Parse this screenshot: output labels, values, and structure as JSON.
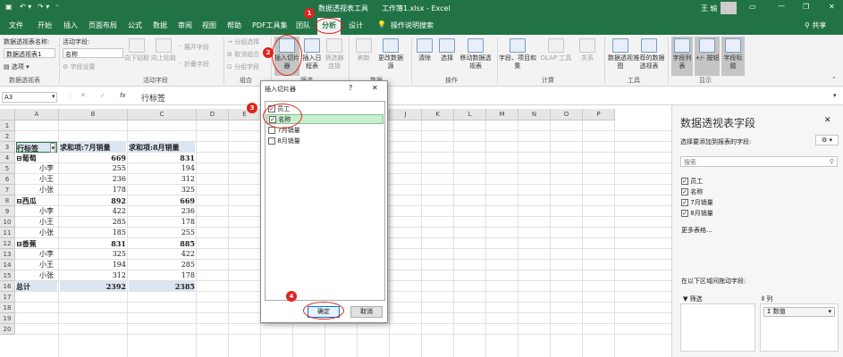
{
  "title_bar": {
    "context_tool": "数据透视表工具",
    "filename": "工作簿1.xlsx - Excel",
    "user": "王 瑜"
  },
  "tabs": [
    "文件",
    "开始",
    "插入",
    "页面布局",
    "公式",
    "数据",
    "审阅",
    "视图",
    "帮助",
    "PDF工具集",
    "团队",
    "分析",
    "设计"
  ],
  "tell_me": "操作说明搜索",
  "share": "共享",
  "ribbon": {
    "pivot_name_label": "数据透视表名称:",
    "pivot_name_value": "数据透视表1",
    "options_label": "选项",
    "active_field_label": "活动字段:",
    "active_field_value": "名称",
    "field_settings": "字段设置",
    "drill_down": "向下钻取",
    "drill_up": "向上钻取",
    "expand_field": "展开字段",
    "collapse_field": "折叠字段",
    "group_selection": "分组选择",
    "ungroup": "取消组合",
    "group_field": "分组字段",
    "insert_slicer": "插入切片器",
    "insert_timeline": "插入日程表",
    "filter_connections": "筛选器连接",
    "refresh": "刷新",
    "change_source": "更改数据源",
    "clear": "清除",
    "select": "选择",
    "move_pivot": "移动数据透视表",
    "fields_items_sets": "字段、项目和集",
    "olap_tools": "OLAP 工具",
    "relationships": "关系",
    "pivot_chart": "数据透视图",
    "recommended": "推荐的数据透视表",
    "field_list": "字段列表",
    "plus_minus": "+/- 按钮",
    "field_headers": "字段标题",
    "groups": {
      "pivot_table": "数据透视表",
      "active_field": "活动字段",
      "group": "组合",
      "filter": "筛选",
      "data": "数据",
      "actions": "操作",
      "calculations": "计算",
      "tools": "工具",
      "show": "显示"
    }
  },
  "formula_bar": {
    "name_box": "A3",
    "content": "行标签"
  },
  "grid": {
    "columns": [
      "A",
      "B",
      "C",
      "D",
      "E",
      "F",
      "G",
      "H",
      "I",
      "J",
      "K",
      "L",
      "M",
      "N",
      "O",
      "P"
    ],
    "rows": [
      "1",
      "2",
      "3",
      "4",
      "5",
      "6",
      "7",
      "8",
      "9",
      "10",
      "11",
      "12",
      "13",
      "14",
      "15",
      "16",
      "17",
      "18",
      "19",
      "20"
    ],
    "header": {
      "a": "行标签",
      "b": "求和项:7月销量",
      "c": "求和项:8月销量"
    },
    "data_rows": [
      {
        "a": "⊟葡萄",
        "b": "669",
        "c": "831",
        "bold": true
      },
      {
        "a": "小李",
        "b": "255",
        "c": "194",
        "bold": false
      },
      {
        "a": "小王",
        "b": "236",
        "c": "312",
        "bold": false
      },
      {
        "a": "小张",
        "b": "178",
        "c": "325",
        "bold": false
      },
      {
        "a": "⊟西瓜",
        "b": "892",
        "c": "669",
        "bold": true
      },
      {
        "a": "小李",
        "b": "422",
        "c": "236",
        "bold": false
      },
      {
        "a": "小王",
        "b": "285",
        "c": "178",
        "bold": false
      },
      {
        "a": "小张",
        "b": "185",
        "c": "255",
        "bold": false
      },
      {
        "a": "⊟香蕉",
        "b": "831",
        "c": "885",
        "bold": true
      },
      {
        "a": "小李",
        "b": "325",
        "c": "422",
        "bold": false
      },
      {
        "a": "小王",
        "b": "194",
        "c": "285",
        "bold": false
      },
      {
        "a": "小张",
        "b": "312",
        "c": "178",
        "bold": false
      },
      {
        "a": "总计",
        "b": "2392",
        "c": "2385",
        "bold": true
      }
    ]
  },
  "dialog": {
    "title": "插入切片器",
    "help": "?",
    "close": "✕",
    "items": [
      {
        "label": "员工",
        "checked": true
      },
      {
        "label": "名称",
        "checked": true
      },
      {
        "label": "7月销量",
        "checked": false
      },
      {
        "label": "8月销量",
        "checked": false
      }
    ],
    "ok": "确定",
    "cancel": "取消"
  },
  "pane": {
    "title": "数据透视表字段",
    "subtitle": "选择要添加到报表的字段:",
    "search_placeholder": "搜索",
    "fields": [
      {
        "label": "员工",
        "checked": true
      },
      {
        "label": "名称",
        "checked": true
      },
      {
        "label": "7月销量",
        "checked": true
      },
      {
        "label": "8月销量",
        "checked": true
      }
    ],
    "more_tables": "更多表格...",
    "drag_hint": "在以下区域间拖动字段:",
    "filters": "筛选",
    "columns": "列",
    "values_item": "Σ 数值"
  },
  "badges": [
    "1",
    "2",
    "3",
    "4"
  ],
  "colors": {
    "excel_green": "#217346",
    "highlight_red": "#e0231b",
    "pivot_header": "#dce6f1"
  }
}
